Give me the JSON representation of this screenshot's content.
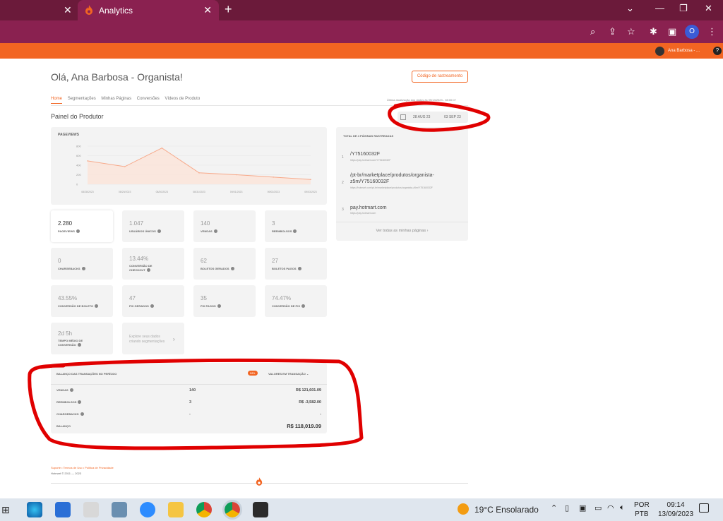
{
  "browser": {
    "tab_title": "Analytics",
    "profile_initial": "O"
  },
  "topbar": {
    "user_name": "Ana Barbosa - ...",
    "help": "?"
  },
  "page": {
    "greeting": "Olá, Ana Barbosa - Organista!",
    "tracking_button": "Código de rastreamento",
    "nav": [
      "Home",
      "Segmentações",
      "Minhas Páginas",
      "Conversões",
      "Vídeos de Produto"
    ],
    "updated_text": "Última atualização dos dados às 09/13/2023 - 08:00:07",
    "section_title": "Painel do Produtor",
    "date_start": "28 AUG 23",
    "date_end": "03 SEP 23"
  },
  "chart_data": {
    "type": "area",
    "title": "PAGEVIEWS",
    "x": [
      "08/28/2023",
      "08/29/2023",
      "08/30/2023",
      "08/31/2023",
      "09/01/2023",
      "09/02/2023",
      "09/03/2023"
    ],
    "values": [
      490,
      370,
      760,
      240,
      200,
      150,
      100
    ],
    "y_ticks": [
      "800",
      "600",
      "400",
      "200",
      "0"
    ],
    "ylim": [
      0,
      800
    ],
    "color": "#f7a98a",
    "grid": true
  },
  "pages": {
    "title": "TOTAL DE 4 PÁGINAS RASTREADAS",
    "items": [
      {
        "num": "1",
        "name": "/Y75160032F",
        "url": "https://pay.hotmart.com/Y75160032F"
      },
      {
        "num": "2",
        "name": "/pt-br/marketplace/produtos/organista-z5m/Y75160032F",
        "url": "https://hotmart.com/pt-br/marketplace/produtos/organista-z5m/Y75160032F"
      },
      {
        "num": "3",
        "name": "pay.hotmart.com",
        "url": "https://pay.hotmart.com"
      }
    ],
    "see_all": "Ver todas as minhas páginas"
  },
  "metrics": [
    {
      "value": "2.280",
      "label": "PAGEVIEWS"
    },
    {
      "value": "1.047",
      "label": "USUÁRIOS ÚNICOS"
    },
    {
      "value": "140",
      "label": "VENDAS"
    },
    {
      "value": "3",
      "label": "REEMBOLSOS"
    },
    {
      "value": "0",
      "label": "CHARGEBACKS"
    },
    {
      "value": "13.44%",
      "label": "CONVERSÃO DE CHECKOUT"
    },
    {
      "value": "62",
      "label": "BOLETOS GERADOS"
    },
    {
      "value": "27",
      "label": "BOLETOS PAGOS"
    },
    {
      "value": "43.55%",
      "label": "CONVERSÃO DE BOLETO"
    },
    {
      "value": "47",
      "label": "PIX GERADOS"
    },
    {
      "value": "35",
      "label": "PIX PAGOS"
    },
    {
      "value": "74.47%",
      "label": "CONVERSÃO DE PIX"
    },
    {
      "value": "2d 5h",
      "label": "TEMPO MÉDIO DE CONVERSÃO"
    }
  ],
  "explore": {
    "text": "Explore seus dados criando segmentações"
  },
  "balance": {
    "title": "BALANÇO DAS TRANSAÇÕES NO PERÍODO",
    "currency": "BRL",
    "values_label": "VALORES EM TRANSAÇÃO",
    "rows": [
      {
        "label": "VENDAS",
        "count": "140",
        "amount": "R$ 121,601.09"
      },
      {
        "label": "REEMBOLSOS",
        "count": "3",
        "amount": "R$ -3,582.00"
      },
      {
        "label": "CHARGEBACKS",
        "count": "-",
        "amount": "-"
      }
    ],
    "total_label": "BALANÇO",
    "total_amount": "R$ 118,019.09"
  },
  "footer": {
    "links": "Suporte  •  Termos de Uso  •  Política de Privacidade",
    "copyright": "Hotmart © 2011 — 2023"
  },
  "taskbar": {
    "weather": "19°C  Ensolarado",
    "lang_1": "POR",
    "lang_2": "PTB",
    "time": "09:14",
    "date": "13/09/2023"
  },
  "colors": {
    "brand_orange": "#f26522",
    "browser_frame": "#8a2150",
    "annotation_red": "#e00000"
  }
}
